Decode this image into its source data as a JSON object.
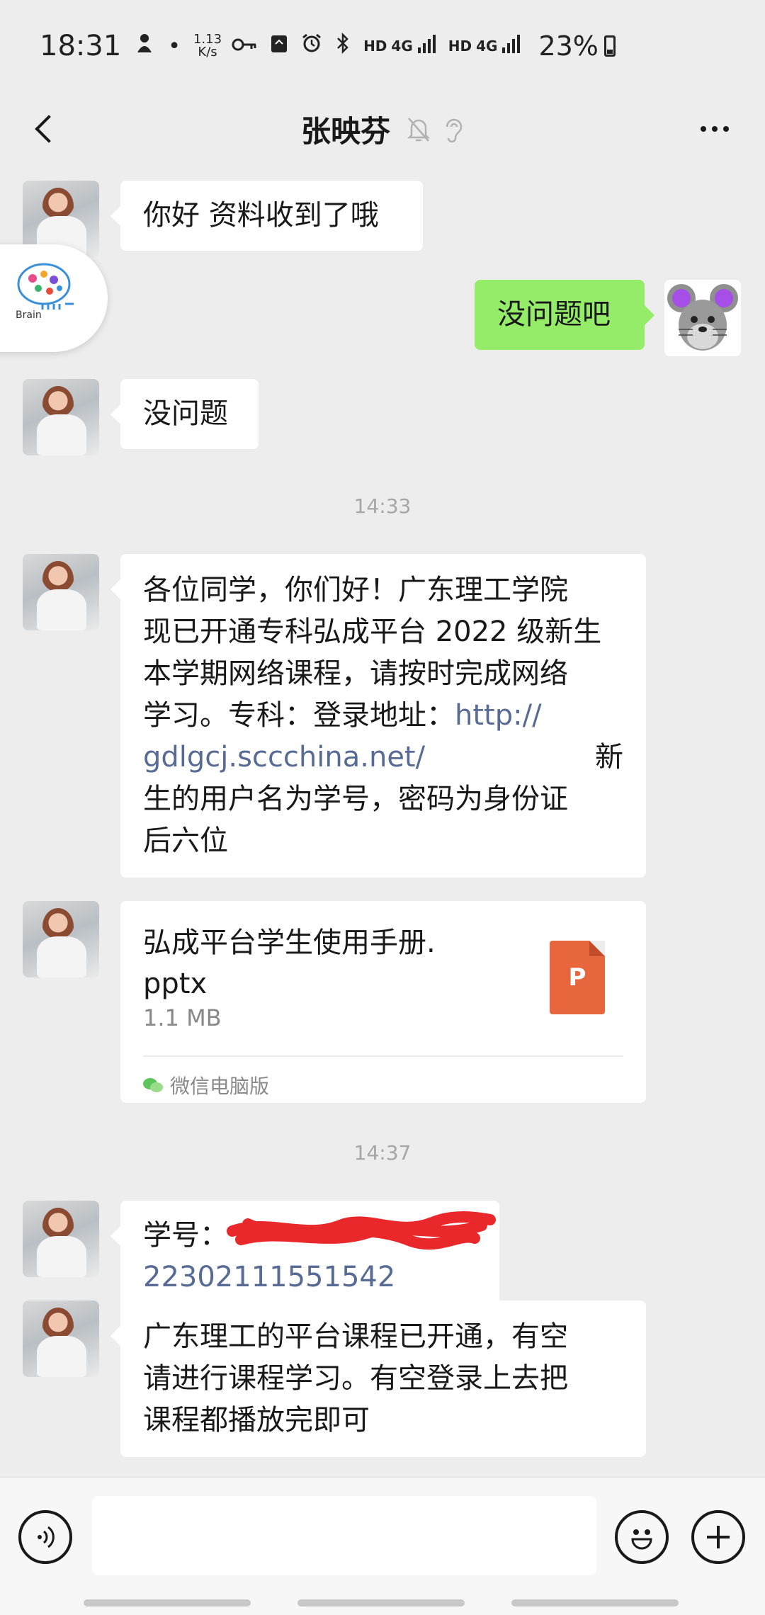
{
  "status_bar": {
    "time": "18:31",
    "speed_value": "1.13",
    "speed_unit": "K/s",
    "net_hd_1": "HD",
    "net_4g_1": "4G",
    "net_hd_2": "HD",
    "net_4g_2": "4G",
    "battery": "23%"
  },
  "header": {
    "title": "张映芬",
    "icons": [
      "bell-muted-icon",
      "ear-icon"
    ]
  },
  "floating_widget": {
    "label": "Brain"
  },
  "messages": [
    {
      "side": "left",
      "text": "你好 资料收到了哦"
    },
    {
      "side": "right",
      "text": "没问题吧"
    },
    {
      "side": "left",
      "text": "没问题"
    },
    {
      "type": "timestamp",
      "text": "14:33"
    },
    {
      "side": "left",
      "line1": "各位同学，你们好！广东理工学院",
      "line2": "现已开通专科弘成平台 2022 级新生",
      "line3": "本学期网络课程，请按时完成网络",
      "line4_text": "学习。专科：登录地址：",
      "line4_link": "http://",
      "line5_link": "gdlgcj.sccchina.net/",
      "line5_text": "新",
      "line6": "生的用户名为学号，密码为身份证",
      "line7": "后六位"
    },
    {
      "type": "file",
      "name_line1": "弘成平台学生使用手册.",
      "name_line2": "pptx",
      "size": "1.1 MB",
      "icon_letter": "P",
      "source": "微信电脑版"
    },
    {
      "type": "timestamp",
      "text": "14:37"
    },
    {
      "side": "left",
      "label": "学号：",
      "value": "22302111551542"
    },
    {
      "side": "left",
      "line1": "广东理工的平台课程已开通，有空",
      "line2": "请进行课程学习。有空登录上去把",
      "line3": "课程都播放完即可"
    }
  ],
  "input_bar": {
    "placeholder": "",
    "icons": [
      "voice-icon",
      "emoji-icon",
      "plus-icon"
    ]
  },
  "colors": {
    "background": "#ededed",
    "sent_bubble": "#95ec69",
    "received_bubble": "#ffffff",
    "link": "#576b95",
    "ppt_icon": "#e8663d",
    "scribble": "#e8282a"
  }
}
